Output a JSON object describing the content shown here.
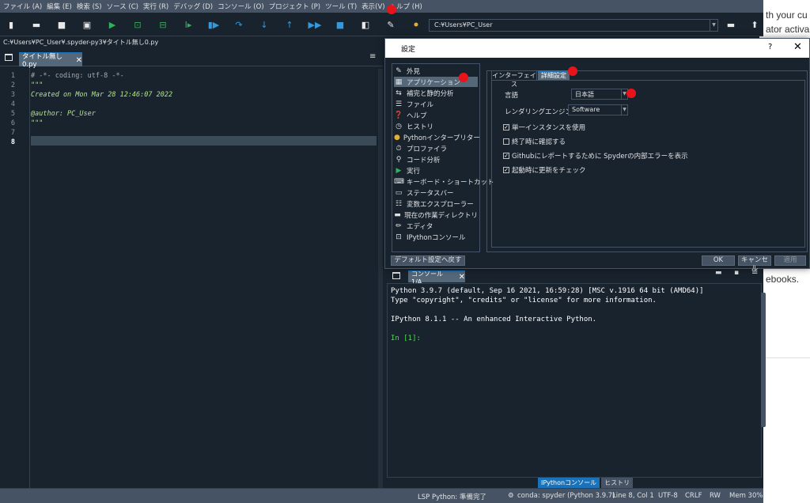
{
  "menu": [
    "ファイル (A)",
    "編集 (E)",
    "検索 (S)",
    "ソース (C)",
    "実行 (R)",
    "デバッグ (D)",
    "コンソール (O)",
    "プロジェクト (P)",
    "ツール (T)",
    "表示(V)",
    "ヘルプ (H)"
  ],
  "toolbar": {
    "path": "C:¥Users¥PC_User",
    "icons": [
      "new-file-icon",
      "open-icon",
      "save-icon",
      "save-all-icon",
      "run-icon",
      "run-cell-icon",
      "run-cell-advance-icon",
      "run-selection-icon",
      "debug-icon",
      "step-icon",
      "step-into-icon",
      "step-return-icon",
      "continue-icon",
      "stop-icon",
      "maximize-pane-icon",
      "wrench-icon",
      "python-icon",
      "browse-folder-icon",
      "parent-directory-icon"
    ]
  },
  "editor": {
    "file_path": "C:¥Users¥PC_User¥.spyder-py3¥タイトル無し0.py",
    "tab_label": "タイトル無し0.py",
    "lines": [
      {
        "n": "1",
        "text": "# -*- coding: utf-8 -*-",
        "kind": "comment"
      },
      {
        "n": "2",
        "text": "\"\"\"",
        "kind": "string"
      },
      {
        "n": "3",
        "text": "Created on Mon Mar 28 12:46:07 2022",
        "kind": "string"
      },
      {
        "n": "4",
        "text": "",
        "kind": "string"
      },
      {
        "n": "5",
        "text": "@author: PC_User",
        "kind": "string"
      },
      {
        "n": "6",
        "text": "\"\"\"",
        "kind": "string"
      },
      {
        "n": "7",
        "text": "",
        "kind": "normal"
      },
      {
        "n": "8",
        "text": "",
        "kind": "normal"
      }
    ],
    "current_line": "8"
  },
  "dialog": {
    "title": "設定",
    "help": "?",
    "close": "✕",
    "nav": [
      {
        "label": "外見",
        "icon": "brush-icon"
      },
      {
        "label": "アプリケーション",
        "icon": "application-icon"
      },
      {
        "label": "補完と静的分析",
        "icon": "completion-icon"
      },
      {
        "label": "ファイル",
        "icon": "files-icon"
      },
      {
        "label": "ヘルプ",
        "icon": "help-icon"
      },
      {
        "label": "ヒストリ",
        "icon": "history-icon"
      },
      {
        "label": "Pythonインタープリター",
        "icon": "python-icon"
      },
      {
        "label": "プロファイラ",
        "icon": "profiler-icon"
      },
      {
        "label": "コード分析",
        "icon": "code-analysis-icon"
      },
      {
        "label": "実行",
        "icon": "run-icon"
      },
      {
        "label": "キーボード・ショートカット",
        "icon": "keyboard-icon"
      },
      {
        "label": "ステータスバー",
        "icon": "statusbar-icon"
      },
      {
        "label": "変数エクスプローラー",
        "icon": "variable-explorer-icon"
      },
      {
        "label": "現在の作業ディレクトリ",
        "icon": "folder-icon"
      },
      {
        "label": "エディタ",
        "icon": "editor-icon"
      },
      {
        "label": "IPythonコンソール",
        "icon": "ipython-icon"
      }
    ],
    "selected_nav": 1,
    "tabs": [
      "インターフェイス",
      "詳細設定"
    ],
    "language_label": "言語",
    "language_value": "日本語",
    "render_label": "レンダリングエンジン:",
    "render_value": "Software",
    "checks": [
      {
        "label": "単一インスタンスを使用",
        "checked": true
      },
      {
        "label": "終了時に確認する",
        "checked": false
      },
      {
        "label": "Githubにレポートするために Spyderの内部エラーを表示",
        "checked": true
      },
      {
        "label": "起動時に更新をチェック",
        "checked": true
      }
    ],
    "reset_button": "デフォルト設定へ戻す",
    "ok_button": "OK",
    "cancel_button": "キャンセル",
    "apply_button": "適用"
  },
  "console": {
    "tab_label": "コンソール 1/A",
    "lines": [
      "Python 3.9.7 (default, Sep 16 2021, 16:59:28) [MSC v.1916 64 bit (AMD64)]",
      "Type \"copyright\", \"credits\" or \"license\" for more information.",
      "",
      "IPython 8.1.1 -- An enhanced Interactive Python.",
      ""
    ],
    "prompt": "In [1]:",
    "pane_tabs": [
      "IPythonコンソール",
      "ヒストリ"
    ]
  },
  "statusbar": {
    "lsp": "LSP Python: 準備完了",
    "conda": "conda: spyder (Python 3.9.7)",
    "position": "Line 8, Col 1",
    "encoding": "UTF-8",
    "eol": "CRLF",
    "rw": "RW",
    "mem": "Mem 30%"
  },
  "background_page": {
    "line1": "th your cu",
    "line2": "ator activa",
    "line3": "ebooks."
  },
  "colors": {
    "marker": "#e8141b",
    "accent": "#1a72bb",
    "background": "#19232d"
  }
}
